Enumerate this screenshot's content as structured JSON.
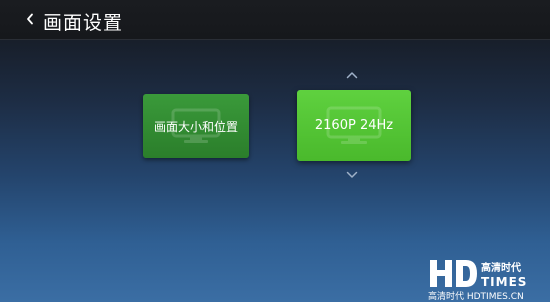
{
  "header": {
    "back_icon": "chevron-left-icon",
    "title": "画面设置"
  },
  "tiles": [
    {
      "label": "画面大小和位置",
      "icon": "monitor-icon",
      "selected": false
    },
    {
      "label": "2160P 24Hz",
      "icon": "monitor-icon",
      "selected": true
    }
  ],
  "selector_arrows": {
    "up_icon": "chevron-up-icon",
    "down_icon": "chevron-down-icon"
  },
  "watermark": {
    "logo_text": "HDTIMES",
    "logo_chinese": "高清时代",
    "caption": "高清时代 HDTIMES.CN"
  },
  "colors": {
    "header_bg": "#16181c",
    "tile_normal": "#2f8a2f",
    "tile_selected": "#52c232",
    "background_top": "#181f2b",
    "background_bottom": "#3b6ea4"
  }
}
